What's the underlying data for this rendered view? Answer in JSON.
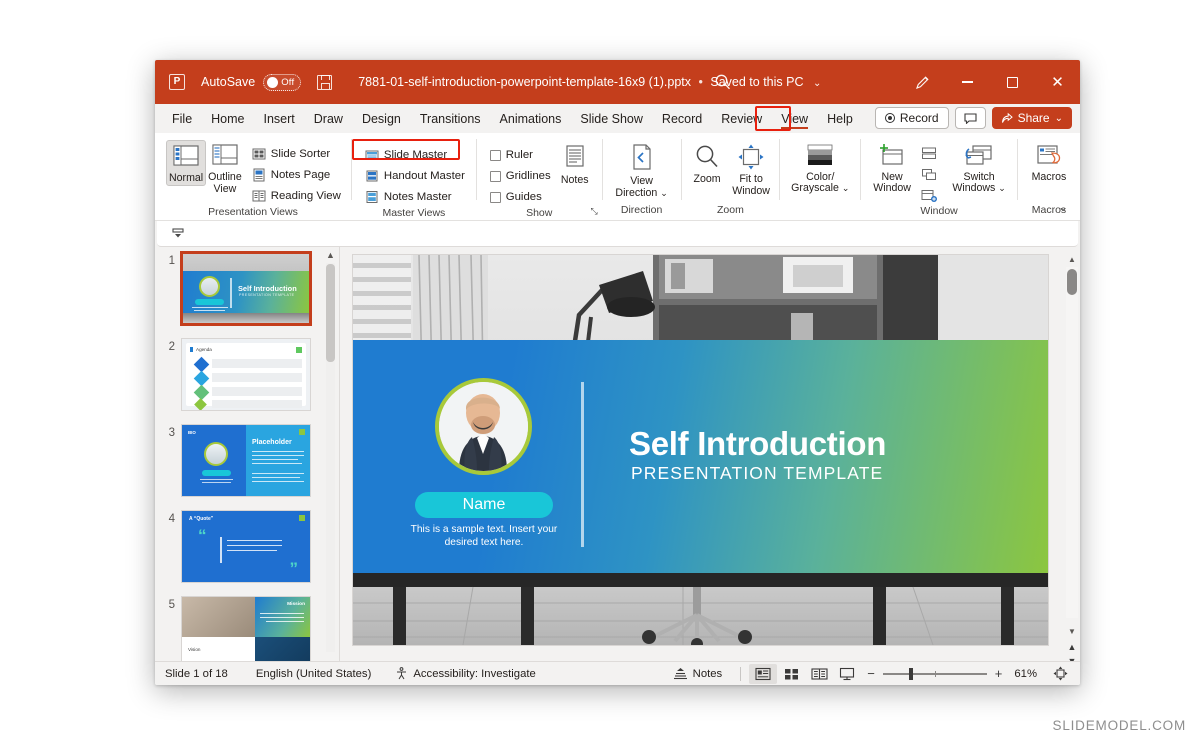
{
  "titlebar": {
    "app_icon": "powerpoint-icon",
    "autosave_label": "AutoSave",
    "autosave_state": "Off",
    "save_icon": "save-icon",
    "filename": "7881-01-self-introduction-powerpoint-template-16x9 (1).pptx",
    "save_status": "Saved to this PC",
    "separator": "•",
    "chevron": "⌄",
    "search_icon": "search-icon",
    "pen_icon": "ink-pen-icon",
    "minimize_icon": "minimize-icon",
    "maximize_icon": "maximize-icon",
    "close_icon": "close-icon",
    "close_glyph": "✕",
    "accent_color": "#c43e1c"
  },
  "tabs": [
    {
      "label": "File"
    },
    {
      "label": "Home"
    },
    {
      "label": "Insert"
    },
    {
      "label": "Draw"
    },
    {
      "label": "Design"
    },
    {
      "label": "Transitions"
    },
    {
      "label": "Animations"
    },
    {
      "label": "Slide Show"
    },
    {
      "label": "Record"
    },
    {
      "label": "Review"
    },
    {
      "label": "View"
    },
    {
      "label": "Help"
    }
  ],
  "active_tab": "View",
  "tab_actions": {
    "record_label": "Record",
    "comments_icon": "comment-icon",
    "share_label": "Share",
    "share_chevron": "⌄",
    "share_icon": "share-icon"
  },
  "ribbon": {
    "groups": [
      {
        "name": "Presentation Views",
        "label": "Presentation Views",
        "big_buttons": [
          {
            "label": "Normal",
            "icon": "normal-view-icon",
            "selected": true
          },
          {
            "label": "Outline View",
            "icon": "outline-view-icon",
            "selected": false
          }
        ],
        "small_buttons": [
          {
            "label": "Slide Sorter",
            "icon": "slide-sorter-icon"
          },
          {
            "label": "Notes Page",
            "icon": "notes-page-icon"
          },
          {
            "label": "Reading View",
            "icon": "reading-view-icon"
          }
        ]
      },
      {
        "name": "Master Views",
        "label": "Master Views",
        "small_buttons": [
          {
            "label": "Slide Master",
            "icon": "slide-master-icon",
            "highlighted": true
          },
          {
            "label": "Handout Master",
            "icon": "handout-master-icon"
          },
          {
            "label": "Notes Master",
            "icon": "notes-master-icon"
          }
        ]
      },
      {
        "name": "Show",
        "label": "Show",
        "checkboxes": [
          {
            "label": "Ruler",
            "checked": false
          },
          {
            "label": "Gridlines",
            "checked": false
          },
          {
            "label": "Guides",
            "checked": false
          }
        ],
        "big_buttons": [
          {
            "label": "Notes",
            "icon": "notes-icon"
          }
        ],
        "dialog_launcher": "⤡"
      },
      {
        "name": "Direction",
        "label": "Direction",
        "big_buttons": [
          {
            "label": "View Direction",
            "icon": "view-direction-icon",
            "chevron": "⌄"
          }
        ]
      },
      {
        "name": "Zoom",
        "label": "Zoom",
        "big_buttons": [
          {
            "label": "Zoom",
            "icon": "zoom-icon"
          },
          {
            "label": "Fit to Window",
            "icon": "fit-to-window-icon"
          }
        ]
      },
      {
        "name": "Color/Grayscale",
        "label": "",
        "big_buttons": [
          {
            "label": "Color/ Grayscale",
            "icon": "color-grayscale-icon",
            "chevron": "⌄"
          }
        ]
      },
      {
        "name": "Window",
        "label": "Window",
        "big_buttons": [
          {
            "label": "New Window",
            "icon": "new-window-icon"
          },
          {
            "label": "Switch Windows",
            "icon": "switch-windows-icon",
            "chevron": "⌄"
          }
        ],
        "small_icons": [
          "arrange-all-icon",
          "cascade-icon",
          "move-split-icon"
        ]
      },
      {
        "name": "Macros",
        "label": "Macros",
        "big_buttons": [
          {
            "label": "Macros",
            "icon": "macros-icon"
          }
        ]
      }
    ],
    "collapse_chevron": "⌄",
    "highlight_color": "#e8200e"
  },
  "subbar": {
    "pin_icon": "ribbon-display-options-icon"
  },
  "thumbnails": {
    "selected": 1,
    "items": [
      {
        "number": "1",
        "kind": "title-slide",
        "title": "Self Introduction",
        "subtitle": "PRESENTATION TEMPLATE",
        "name_label": "Name"
      },
      {
        "number": "2",
        "kind": "agenda-slide",
        "title": "Agenda"
      },
      {
        "number": "3",
        "kind": "bio-slide",
        "title": "Placeholder",
        "eyebrow": "BIO",
        "name_label": "Name"
      },
      {
        "number": "4",
        "kind": "quote-slide",
        "title": "A “Quote”"
      },
      {
        "number": "5",
        "kind": "mission-slide",
        "title": "Mission",
        "secondary": "Vision"
      }
    ],
    "scroll_up_arrow": "▲",
    "scroll_down_arrow": "▼"
  },
  "slide": {
    "title": "Self Introduction",
    "subtitle": "PRESENTATION TEMPLATE",
    "name_label": "Name",
    "body_text": "This is a sample text. Insert your desired text here.",
    "avatar": "person-photo",
    "background": "grayscale-office-desk-photo",
    "gradient_start": "#1f7cd0",
    "gradient_end": "#8cc63f",
    "name_pill_color": "#19c6d8",
    "avatar_ring_color": "#a8c93a"
  },
  "statusbar": {
    "slide_counter": "Slide 1 of 18",
    "language": "English (United States)",
    "accessibility": "Accessibility: Investigate",
    "accessibility_icon": "accessibility-icon",
    "notes_label": "Notes",
    "notes_icon": "notes-caret-icon",
    "views": [
      {
        "name": "normal-view",
        "icon": "normal-view-icon",
        "selected": true
      },
      {
        "name": "slide-sorter-view",
        "icon": "slide-sorter-icon",
        "selected": false
      },
      {
        "name": "reading-view",
        "icon": "reading-view-icon",
        "selected": false
      },
      {
        "name": "slide-show-view",
        "icon": "slide-show-icon",
        "selected": false
      }
    ],
    "zoom_out": "−",
    "zoom_in": "+",
    "zoom_level": "61%",
    "fit_icon": "fit-slide-to-window-icon"
  },
  "watermark": "SLIDEMODEL.COM"
}
